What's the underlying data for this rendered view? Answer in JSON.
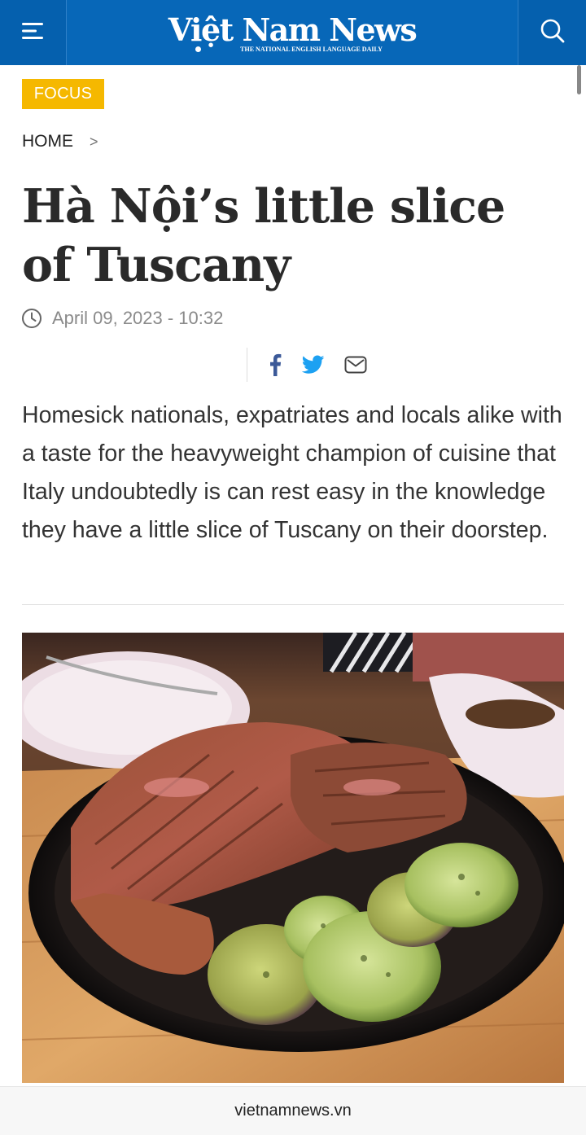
{
  "header": {
    "logo_text": "Việt Nam News",
    "logo_tagline": "THE NATIONAL ENGLISH LANGUAGE DAILY",
    "menu_icon": "menu-icon",
    "search_icon": "search-icon",
    "brand_color": "#0767b8"
  },
  "category": {
    "label": "FOCUS",
    "color": "#f5b800"
  },
  "breadcrumb": {
    "home": "HOME",
    "separator": ">"
  },
  "article": {
    "title": "Hà Nội’s little slice of Tuscany",
    "date": "April 09, 2023 - 10:32",
    "lead": "Homesick nationals, expatriates and locals alike with a taste for the heavyweight champion of cuisine that Italy undoubtedly is can rest easy in the knowledge they have a little slice of Tuscany on their doorstep."
  },
  "share": {
    "icons": [
      "facebook-icon",
      "twitter-icon",
      "mail-icon"
    ],
    "facebook_color": "#3b5998",
    "twitter_color": "#1da1f2"
  },
  "browser": {
    "url": "vietnamnews.vn"
  }
}
